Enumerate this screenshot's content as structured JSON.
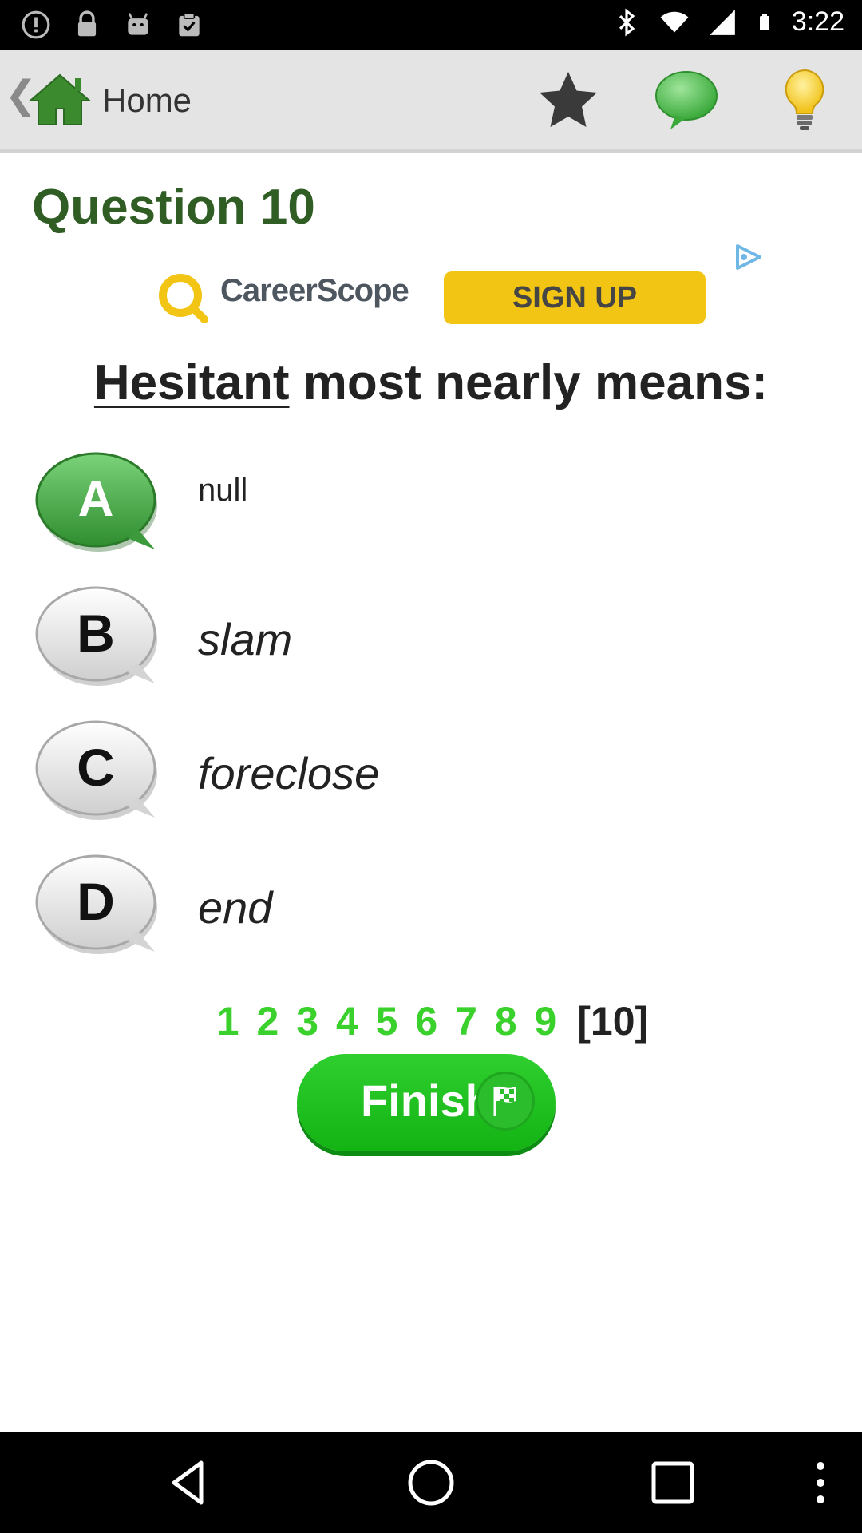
{
  "status_bar": {
    "time": "3:22",
    "left_icons": [
      "alert-circle-icon",
      "lock-icon",
      "android-icon",
      "clipboard-check-icon"
    ],
    "right_icons": [
      "bluetooth-icon",
      "wifi-icon",
      "signal-icon",
      "battery-icon"
    ]
  },
  "action_bar": {
    "back_glyph": "❮",
    "home_label": "Home",
    "icons": [
      "star-icon",
      "chat-bubble-icon",
      "lightbulb-icon"
    ]
  },
  "question": {
    "title": "Question 10",
    "prompt_word": "Hesitant",
    "prompt_rest": " most nearly means:"
  },
  "ad": {
    "brand": "CareerScope",
    "cta": "SIGN UP",
    "accent": "#f2c515"
  },
  "options": [
    {
      "letter": "A",
      "text": "null",
      "selected": true
    },
    {
      "letter": "B",
      "text": "slam",
      "selected": false
    },
    {
      "letter": "C",
      "text": "foreclose",
      "selected": false
    },
    {
      "letter": "D",
      "text": "end",
      "selected": false
    }
  ],
  "pagination": {
    "pages": [
      "1",
      "2",
      "3",
      "4",
      "5",
      "6",
      "7",
      "8",
      "9"
    ],
    "current": "[10]"
  },
  "finish": {
    "label": "Finish"
  },
  "colors": {
    "title_green": "#2f5d24",
    "selected_bubble": "#4aa54a",
    "page_green": "#3bd12c",
    "finish_green": "#1fbf1f"
  }
}
